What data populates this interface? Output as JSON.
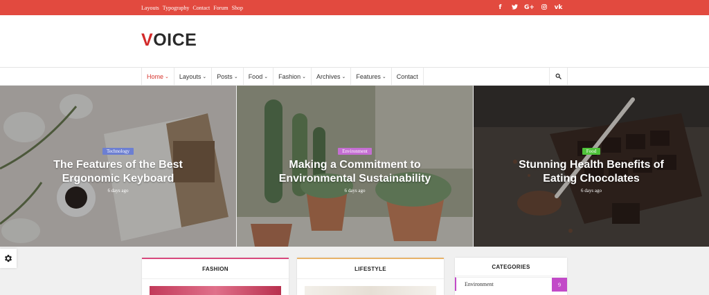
{
  "topbar": {
    "links": [
      "Layouts",
      "Typography",
      "Contact",
      "Forum",
      "Shop"
    ],
    "social": [
      "f",
      "t",
      "G+",
      "ig",
      "vk"
    ]
  },
  "logo": {
    "first": "V",
    "rest": "OICE"
  },
  "nav": {
    "items": [
      {
        "label": "Home",
        "caret": "⌄"
      },
      {
        "label": "Layouts",
        "caret": "⌄"
      },
      {
        "label": "Posts",
        "caret": "⌄"
      },
      {
        "label": "Food",
        "caret": "⌄"
      },
      {
        "label": "Fashion",
        "caret": "⌄"
      },
      {
        "label": "Archives",
        "caret": "⌄"
      },
      {
        "label": "Features",
        "caret": "⌄"
      },
      {
        "label": "Contact",
        "caret": ""
      }
    ]
  },
  "slides": [
    {
      "category": "Technology",
      "color": "#6c7fd2",
      "title_1": "The Features of the Best",
      "title_2": "Ergonomic Keyboard",
      "date": "6 days ago"
    },
    {
      "category": "Environment",
      "color": "#c46ed2",
      "title_1": "Making a Commitment to",
      "title_2": "Environmental Sustainability",
      "date": "6 days ago"
    },
    {
      "category": "Food",
      "color": "#4fc23a",
      "title_1": "Stunning Health Benefits of",
      "title_2": "Eating Chocolates",
      "date": "6 days ago"
    }
  ],
  "cards": {
    "fashion": "FASHION",
    "lifestyle": "LIFESTYLE",
    "categories": "CATEGORIES"
  },
  "categories": [
    {
      "name": "Environment",
      "count": "9"
    }
  ],
  "colors": {
    "accent": "#e24a3f",
    "fashion_border": "#d9487d",
    "lifestyle_border": "#e8b36a"
  }
}
